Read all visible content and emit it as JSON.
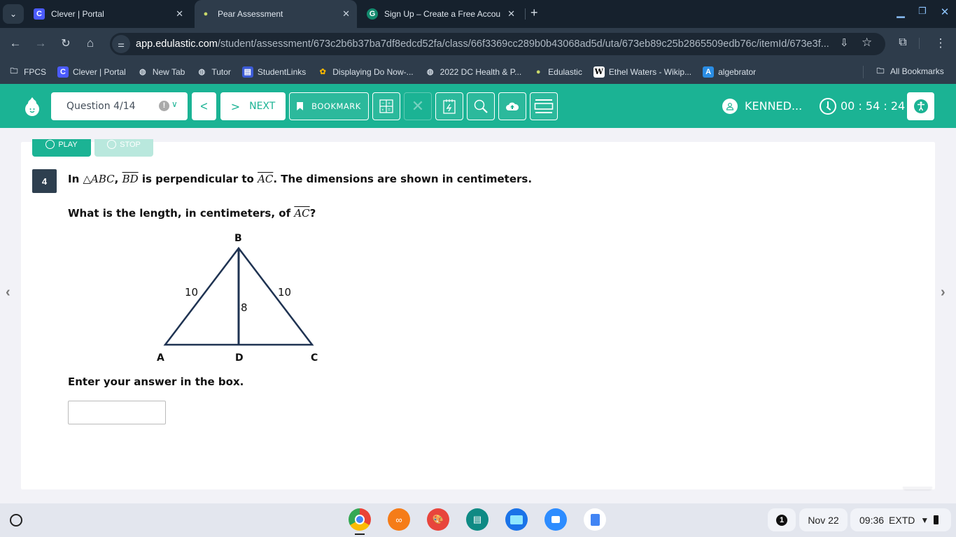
{
  "browser": {
    "tabs": [
      {
        "title": "Clever | Portal",
        "icon": "clever-icon",
        "icon_glyph": "C",
        "icon_color": "#4b5bff",
        "active": false
      },
      {
        "title": "Pear Assessment",
        "icon": "pear-icon",
        "icon_glyph": "🍐",
        "icon_color": "#c9d86a",
        "active": true
      },
      {
        "title": "Sign Up – Create a Free Accou",
        "icon": "grammarly-icon",
        "icon_glyph": "G",
        "icon_color": "#15c39a",
        "active": false
      }
    ],
    "new_tab_glyph": "+",
    "url_host": "app.edulastic.com",
    "url_path": "/student/assessment/673c2b6b37ba7df8edcd52fa/class/66f3369cc289b0b43068ad5d/uta/673eb89c25b2865509edb76c/itemId/673e3f...",
    "bookmarks": [
      {
        "label": "FPCS",
        "icon": "folder-managed-icon"
      },
      {
        "label": "Clever | Portal",
        "icon": "clever-icon"
      },
      {
        "label": "New Tab",
        "icon": "globe-icon"
      },
      {
        "label": "Tutor",
        "icon": "globe-icon"
      },
      {
        "label": "StudentLinks",
        "icon": "studentlinks-icon"
      },
      {
        "label": "Displaying Do Now-...",
        "icon": "google-photos-icon"
      },
      {
        "label": "2022 DC Health & P...",
        "icon": "globe-icon"
      },
      {
        "label": "Edulastic",
        "icon": "pear-icon"
      },
      {
        "label": "Ethel Waters - Wikip...",
        "icon": "wikipedia-icon"
      },
      {
        "label": "algebrator",
        "icon": "algebrator-icon"
      }
    ],
    "all_bookmarks_label": "All Bookmarks"
  },
  "app": {
    "brand_color": "#1bb394",
    "question_select": "Question 4/14",
    "next_label": "NEXT",
    "bookmark_label": "BOOKMARK",
    "user_name": "KENNED...",
    "timer": "00 : 54 : 24",
    "play_label": "PLAY",
    "stop_label": "STOP"
  },
  "question": {
    "number": "4",
    "line1_pre": "In ",
    "line1_tri": "△ABC",
    "line1_comma": ", ",
    "line1_seg1": "BD",
    "line1_mid": " is perpendicular to ",
    "line1_seg2": "AC",
    "line1_post": ". The dimensions are shown in centimeters.",
    "line2_pre": "What is the length, in centimeters, of ",
    "line2_seg": "AC",
    "line2_post": "?",
    "figure": {
      "vertices": {
        "A": "A",
        "B": "B",
        "C": "C",
        "D": "D"
      },
      "side_AB": "10",
      "side_BC": "10",
      "altitude_BD": "8"
    },
    "prompt": "Enter your answer in the box.",
    "answer_value": ""
  },
  "shelf": {
    "apps": [
      "chrome-icon",
      "infinity-app-icon",
      "paint-icon",
      "classroom-icon",
      "files-icon",
      "zoom-icon",
      "docs-icon"
    ],
    "notification_count": "1",
    "date": "Nov 22",
    "time": "09:36",
    "status": "EXTD"
  }
}
